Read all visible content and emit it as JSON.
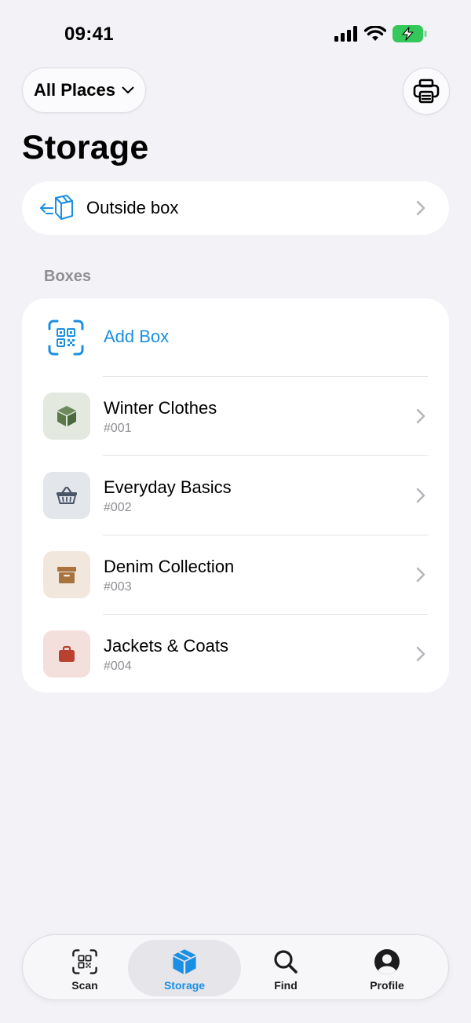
{
  "status_bar": {
    "time": "09:41",
    "icons": [
      "cellular-signal-icon",
      "wifi-icon",
      "battery-charging-icon"
    ]
  },
  "header": {
    "place_picker_label": "All Places",
    "place_picker_icon": "chevron-down-icon",
    "print_icon": "printer-icon",
    "title": "Storage"
  },
  "outside_box": {
    "label": "Outside box",
    "icon": "box-out-icon"
  },
  "boxes_section": {
    "header": "Boxes",
    "add_label": "Add Box",
    "add_icon": "qr-scan-icon",
    "items": [
      {
        "name": "Winter Clothes",
        "code": "#001",
        "icon": "cube-icon",
        "color": "#5b7a4a",
        "bg": "#e3e9de"
      },
      {
        "name": "Everyday Basics",
        "code": "#002",
        "icon": "basket-icon",
        "color": "#4a5567",
        "bg": "#e3e6ea"
      },
      {
        "name": "Denim Collection",
        "code": "#003",
        "icon": "archive-box-icon",
        "color": "#a8733e",
        "bg": "#f1e7dd"
      },
      {
        "name": "Jackets & Coats",
        "code": "#004",
        "icon": "bag-icon",
        "color": "#b8412f",
        "bg": "#f3e0dc"
      }
    ]
  },
  "tab_bar": {
    "tabs": [
      {
        "label": "Scan",
        "icon": "qr-scan-icon",
        "active": false
      },
      {
        "label": "Storage",
        "icon": "cube-icon",
        "active": true
      },
      {
        "label": "Find",
        "icon": "search-icon",
        "active": false
      },
      {
        "label": "Profile",
        "icon": "person-circle-icon",
        "active": false
      }
    ]
  },
  "colors": {
    "accent": "#1a8fe3",
    "background": "#f2f2f7",
    "secondary_text": "#8e8e93",
    "battery": "#34c759"
  }
}
